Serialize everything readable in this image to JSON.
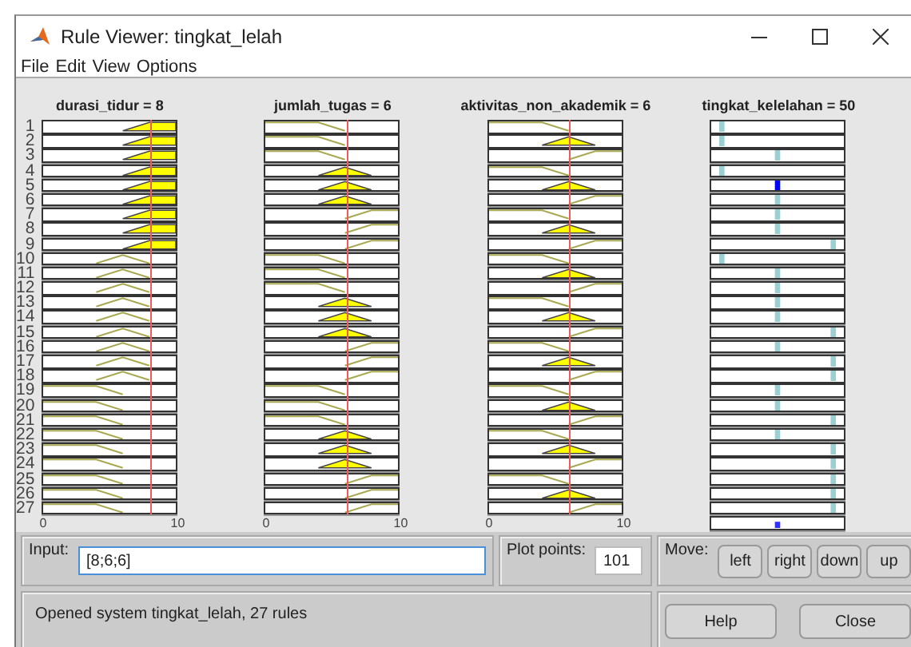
{
  "window": {
    "title": "Rule Viewer: tingkat_lelah"
  },
  "menu": [
    "File",
    "Edit",
    "View",
    "Options"
  ],
  "inputs": [
    {
      "label": "durasi_tidur = 8",
      "level": 0.8,
      "ticks": [
        "0",
        "10"
      ]
    },
    {
      "label": "jumlah_tugas = 6",
      "level": 0.6,
      "ticks": [
        "0",
        "10"
      ]
    },
    {
      "label": "aktivitas_non_akademik = 6",
      "level": 0.6,
      "ticks": [
        "0",
        "10"
      ]
    }
  ],
  "output": {
    "label": "tingkat_kelelahan = 50"
  },
  "rules": [
    {
      "number": "1",
      "inputs": [
        {
          "kind": "high",
          "fired": true
        },
        {
          "kind": "low",
          "fired": false
        },
        {
          "kind": "low",
          "fired": false
        }
      ],
      "output": {
        "kind": "low",
        "fired": false
      }
    },
    {
      "number": "2",
      "inputs": [
        {
          "kind": "high",
          "fired": true
        },
        {
          "kind": "low",
          "fired": false
        },
        {
          "kind": "mid",
          "fired": true
        }
      ],
      "output": {
        "kind": "low",
        "fired": false
      }
    },
    {
      "number": "3",
      "inputs": [
        {
          "kind": "high",
          "fired": true
        },
        {
          "kind": "low",
          "fired": false
        },
        {
          "kind": "high",
          "fired": false
        }
      ],
      "output": {
        "kind": "mid",
        "fired": false
      }
    },
    {
      "number": "4",
      "inputs": [
        {
          "kind": "high",
          "fired": true
        },
        {
          "kind": "mid",
          "fired": true
        },
        {
          "kind": "low",
          "fired": false
        }
      ],
      "output": {
        "kind": "low",
        "fired": false
      }
    },
    {
      "number": "5",
      "inputs": [
        {
          "kind": "high",
          "fired": true
        },
        {
          "kind": "mid",
          "fired": true
        },
        {
          "kind": "mid",
          "fired": true
        }
      ],
      "output": {
        "kind": "mid",
        "fired": true
      }
    },
    {
      "number": "6",
      "inputs": [
        {
          "kind": "high",
          "fired": true
        },
        {
          "kind": "mid",
          "fired": true
        },
        {
          "kind": "high",
          "fired": false
        }
      ],
      "output": {
        "kind": "mid",
        "fired": false
      }
    },
    {
      "number": "7",
      "inputs": [
        {
          "kind": "high",
          "fired": true
        },
        {
          "kind": "high",
          "fired": false
        },
        {
          "kind": "low",
          "fired": false
        }
      ],
      "output": {
        "kind": "mid",
        "fired": false
      }
    },
    {
      "number": "8",
      "inputs": [
        {
          "kind": "high",
          "fired": true
        },
        {
          "kind": "high",
          "fired": false
        },
        {
          "kind": "mid",
          "fired": true
        }
      ],
      "output": {
        "kind": "mid",
        "fired": false
      }
    },
    {
      "number": "9",
      "inputs": [
        {
          "kind": "high",
          "fired": true
        },
        {
          "kind": "high",
          "fired": false
        },
        {
          "kind": "high",
          "fired": false
        }
      ],
      "output": {
        "kind": "high",
        "fired": false
      }
    },
    {
      "number": "10",
      "inputs": [
        {
          "kind": "mid",
          "fired": false
        },
        {
          "kind": "low",
          "fired": false
        },
        {
          "kind": "low",
          "fired": false
        }
      ],
      "output": {
        "kind": "low",
        "fired": false
      }
    },
    {
      "number": "11",
      "inputs": [
        {
          "kind": "mid",
          "fired": false
        },
        {
          "kind": "low",
          "fired": false
        },
        {
          "kind": "mid",
          "fired": true
        }
      ],
      "output": {
        "kind": "mid",
        "fired": false
      }
    },
    {
      "number": "12",
      "inputs": [
        {
          "kind": "mid",
          "fired": false
        },
        {
          "kind": "low",
          "fired": false
        },
        {
          "kind": "high",
          "fired": false
        }
      ],
      "output": {
        "kind": "mid",
        "fired": false
      }
    },
    {
      "number": "13",
      "inputs": [
        {
          "kind": "mid",
          "fired": false
        },
        {
          "kind": "mid",
          "fired": true
        },
        {
          "kind": "low",
          "fired": false
        }
      ],
      "output": {
        "kind": "mid",
        "fired": false
      }
    },
    {
      "number": "14",
      "inputs": [
        {
          "kind": "mid",
          "fired": false
        },
        {
          "kind": "mid",
          "fired": true
        },
        {
          "kind": "mid",
          "fired": true
        }
      ],
      "output": {
        "kind": "mid",
        "fired": false
      }
    },
    {
      "number": "15",
      "inputs": [
        {
          "kind": "mid",
          "fired": false
        },
        {
          "kind": "mid",
          "fired": true
        },
        {
          "kind": "high",
          "fired": false
        }
      ],
      "output": {
        "kind": "high",
        "fired": false
      }
    },
    {
      "number": "16",
      "inputs": [
        {
          "kind": "mid",
          "fired": false
        },
        {
          "kind": "high",
          "fired": false
        },
        {
          "kind": "low",
          "fired": false
        }
      ],
      "output": {
        "kind": "mid",
        "fired": false
      }
    },
    {
      "number": "17",
      "inputs": [
        {
          "kind": "mid",
          "fired": false
        },
        {
          "kind": "high",
          "fired": false
        },
        {
          "kind": "mid",
          "fired": true
        }
      ],
      "output": {
        "kind": "high",
        "fired": false
      }
    },
    {
      "number": "18",
      "inputs": [
        {
          "kind": "mid",
          "fired": false
        },
        {
          "kind": "high",
          "fired": false
        },
        {
          "kind": "high",
          "fired": false
        }
      ],
      "output": {
        "kind": "high",
        "fired": false
      }
    },
    {
      "number": "19",
      "inputs": [
        {
          "kind": "low",
          "fired": false
        },
        {
          "kind": "low",
          "fired": false
        },
        {
          "kind": "low",
          "fired": false
        }
      ],
      "output": {
        "kind": "mid",
        "fired": false
      }
    },
    {
      "number": "20",
      "inputs": [
        {
          "kind": "low",
          "fired": false
        },
        {
          "kind": "low",
          "fired": false
        },
        {
          "kind": "mid",
          "fired": true
        }
      ],
      "output": {
        "kind": "mid",
        "fired": false
      }
    },
    {
      "number": "21",
      "inputs": [
        {
          "kind": "low",
          "fired": false
        },
        {
          "kind": "low",
          "fired": false
        },
        {
          "kind": "high",
          "fired": false
        }
      ],
      "output": {
        "kind": "high",
        "fired": false
      }
    },
    {
      "number": "22",
      "inputs": [
        {
          "kind": "low",
          "fired": false
        },
        {
          "kind": "mid",
          "fired": true
        },
        {
          "kind": "low",
          "fired": false
        }
      ],
      "output": {
        "kind": "mid",
        "fired": false
      }
    },
    {
      "number": "23",
      "inputs": [
        {
          "kind": "low",
          "fired": false
        },
        {
          "kind": "mid",
          "fired": true
        },
        {
          "kind": "mid",
          "fired": true
        }
      ],
      "output": {
        "kind": "high",
        "fired": false
      }
    },
    {
      "number": "24",
      "inputs": [
        {
          "kind": "low",
          "fired": false
        },
        {
          "kind": "mid",
          "fired": true
        },
        {
          "kind": "high",
          "fired": false
        }
      ],
      "output": {
        "kind": "high",
        "fired": false
      }
    },
    {
      "number": "25",
      "inputs": [
        {
          "kind": "low",
          "fired": false
        },
        {
          "kind": "high",
          "fired": false
        },
        {
          "kind": "low",
          "fired": false
        }
      ],
      "output": {
        "kind": "high",
        "fired": false
      }
    },
    {
      "number": "26",
      "inputs": [
        {
          "kind": "low",
          "fired": false
        },
        {
          "kind": "high",
          "fired": false
        },
        {
          "kind": "mid",
          "fired": true
        }
      ],
      "output": {
        "kind": "high",
        "fired": false
      }
    },
    {
      "number": "27",
      "inputs": [
        {
          "kind": "low",
          "fired": false
        },
        {
          "kind": "high",
          "fired": false
        },
        {
          "kind": "high",
          "fired": false
        }
      ],
      "output": {
        "kind": "high",
        "fired": false
      }
    }
  ],
  "controls": {
    "input": {
      "label": "Input:",
      "value": "[8;6;6]"
    },
    "plot_points": {
      "label": "Plot points:",
      "value": "101"
    },
    "move": {
      "label": "Move:",
      "buttons": [
        "left",
        "right",
        "down",
        "up"
      ]
    }
  },
  "status": "Opened system tingkat_lelah, 27 rules",
  "buttons": [
    "Help",
    "Close"
  ]
}
